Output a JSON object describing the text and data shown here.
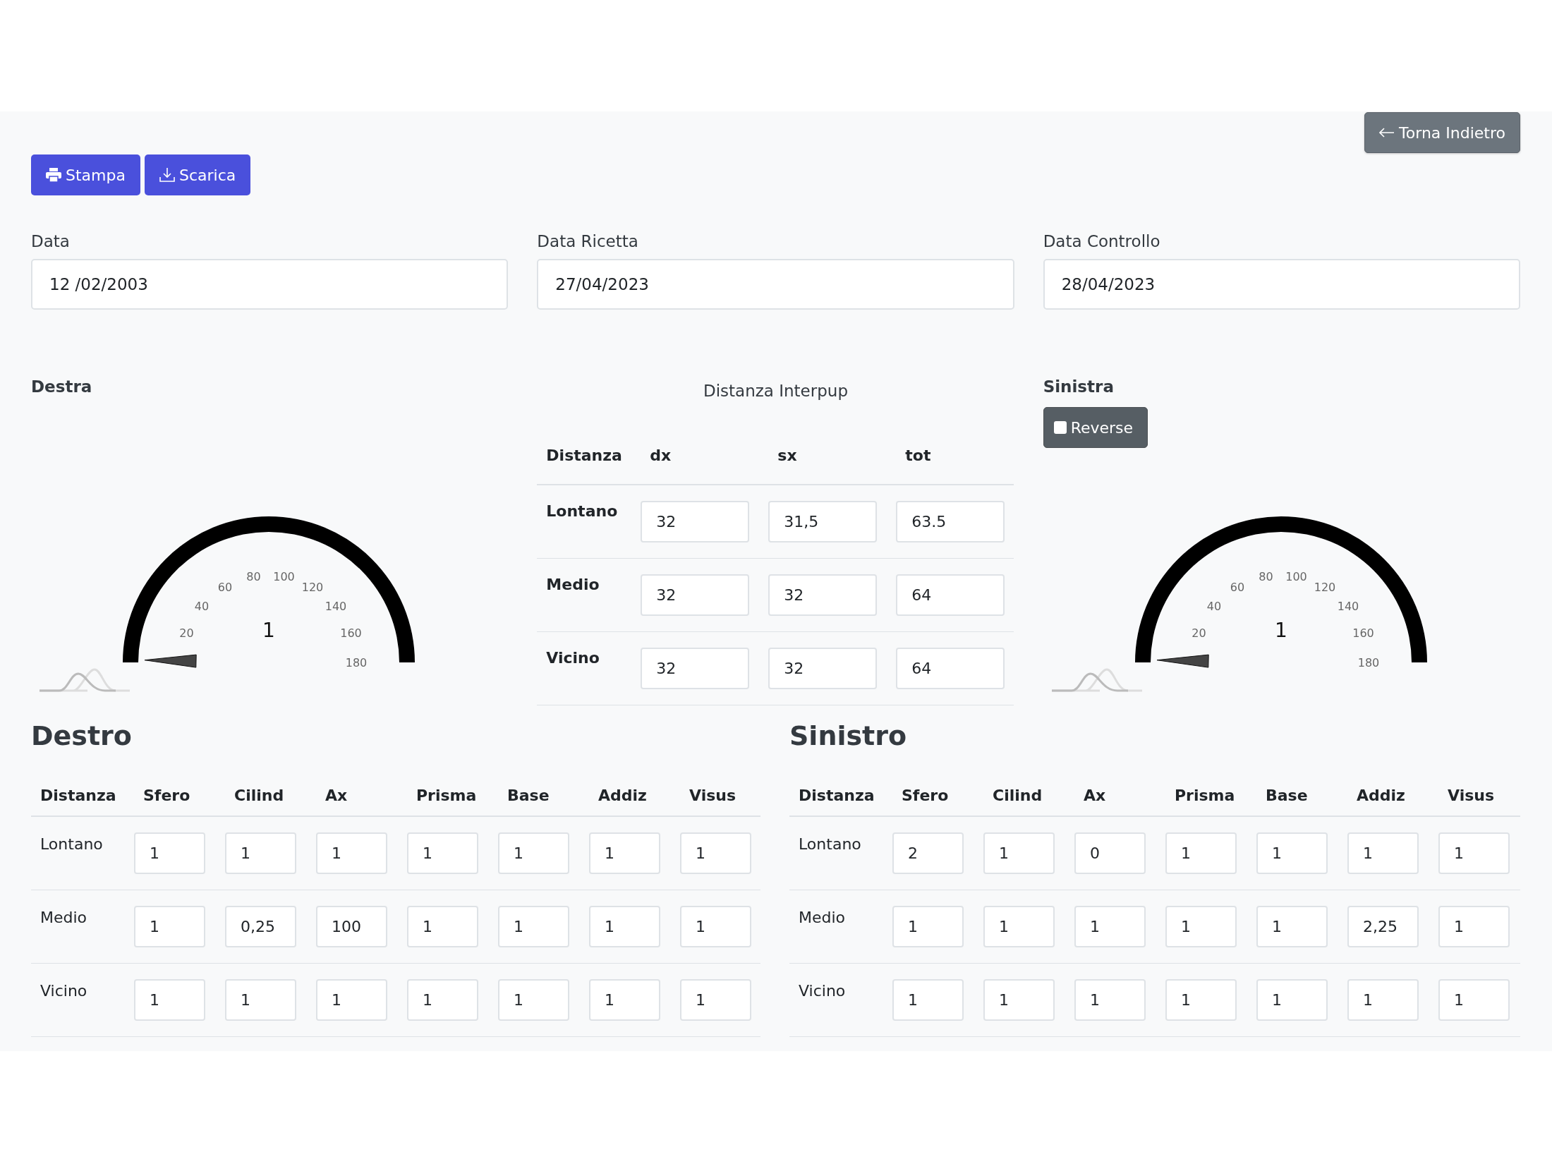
{
  "toolbar": {
    "back_button": {
      "label": "Torna Indietro"
    },
    "actions": [
      {
        "label": "Stampa",
        "kind": "print"
      },
      {
        "label": "Scarica",
        "kind": "download"
      }
    ]
  },
  "date_fields": [
    {
      "label": "Data",
      "value": "12 /02/2003"
    },
    {
      "label": "Data Ricetta",
      "value": "27/04/2023"
    },
    {
      "label": "Data Controllo",
      "value": "28/04/2023"
    }
  ],
  "right_eye": {
    "title": "Destra",
    "gauge": {
      "ticks": [
        "20",
        "40",
        "60",
        "80",
        "100",
        "120",
        "140",
        "160",
        "180"
      ],
      "value": "1"
    }
  },
  "interpupillary": {
    "title": "Distanza Interpup",
    "columns": [
      "Distanza",
      "dx",
      "sx",
      "tot"
    ],
    "rows": [
      {
        "label": "Lontano",
        "values": [
          "32",
          "31,5",
          "63.5"
        ]
      },
      {
        "label": "Medio",
        "values": [
          "32",
          "32",
          "64"
        ]
      },
      {
        "label": "Vicino",
        "values": [
          "32",
          "32",
          "64"
        ]
      }
    ]
  },
  "left_eye": {
    "title": "Sinistra",
    "reverse": {
      "label": "Reverse",
      "checked": false
    },
    "gauge": {
      "ticks": [
        "20",
        "40",
        "60",
        "80",
        "100",
        "120",
        "140",
        "160",
        "180"
      ],
      "value": "1"
    }
  },
  "prescriptions": [
    {
      "title": "Destro",
      "columns": [
        "Distanza",
        "Sfero",
        "Cilind",
        "Ax",
        "Prisma",
        "Base",
        "Addiz",
        "Visus"
      ],
      "rows": [
        {
          "label": "Lontano",
          "values": [
            "1",
            "1",
            "1",
            "1",
            "1",
            "1",
            "1"
          ]
        },
        {
          "label": "Medio",
          "values": [
            "1",
            "0,25",
            "100",
            "1",
            "1",
            "1",
            "1"
          ]
        },
        {
          "label": "Vicino",
          "values": [
            "1",
            "1",
            "1",
            "1",
            "1",
            "1",
            "1"
          ]
        }
      ]
    },
    {
      "title": "Sinistro",
      "columns": [
        "Distanza",
        "Sfero",
        "Cilind",
        "Ax",
        "Prisma",
        "Base",
        "Addiz",
        "Visus"
      ],
      "rows": [
        {
          "label": "Lontano",
          "values": [
            "2",
            "1",
            "0",
            "1",
            "1",
            "1",
            "1"
          ]
        },
        {
          "label": "Medio",
          "values": [
            "1",
            "1",
            "1",
            "1",
            "1",
            "2,25",
            "1"
          ]
        },
        {
          "label": "Vicino",
          "values": [
            "1",
            "1",
            "1",
            "1",
            "1",
            "1",
            "1"
          ]
        }
      ]
    }
  ]
}
